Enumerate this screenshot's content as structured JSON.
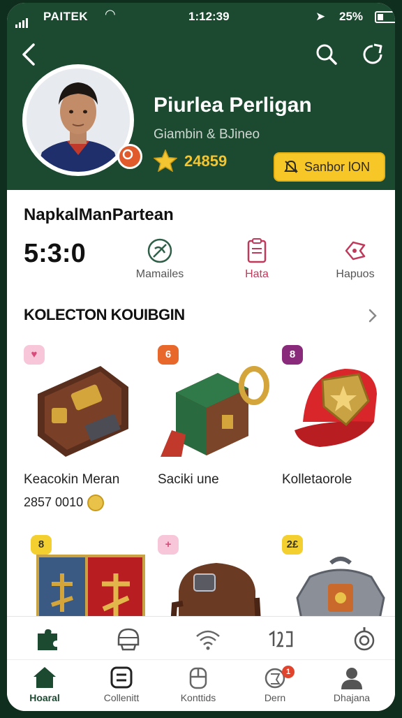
{
  "status_bar": {
    "carrier": "PAITEK",
    "time": "1:12:39",
    "battery": "25%"
  },
  "profile": {
    "name": "Piurlea Perligan",
    "subtitle": "Giambin & BJineo",
    "score": "24859",
    "status_button": "Sanbor lON"
  },
  "section_title": "NapkalManPartean",
  "stats": {
    "big_value": "5:3:0",
    "items": [
      {
        "label": "Mamailes",
        "icon": "compass-icon"
      },
      {
        "label": "Hata",
        "icon": "clipboard-icon"
      },
      {
        "label": "Hapuos",
        "icon": "tag-icon"
      }
    ]
  },
  "collection": {
    "title": "KOLECTON KOUIBGIN",
    "items": [
      {
        "badge": "♥",
        "badge_color": "#f7c7d9",
        "title": "Keacokin Meran",
        "price": "2857 0010",
        "icon": "wallet-icon"
      },
      {
        "badge": "6",
        "badge_color": "#e8682c",
        "title": "Saciki une",
        "price": "",
        "icon": "chest-icon"
      },
      {
        "badge": "8",
        "badge_color": "#8a2a7a",
        "title": "Kolletaorole",
        "price": "",
        "icon": "cap-icon"
      },
      {
        "badge": "8",
        "badge_color": "#f3cf2f",
        "title": "",
        "price": "",
        "icon": "banner-icon"
      },
      {
        "badge": "+",
        "badge_color": "#f7c7d9",
        "title": "",
        "price": "",
        "icon": "backpack-icon"
      },
      {
        "badge": "2£",
        "badge_color": "#f3cf2f",
        "title": "",
        "price": "",
        "icon": "armor-icon"
      }
    ]
  },
  "tabs": [
    {
      "label": "Hoaral",
      "icon": "home-icon"
    },
    {
      "label": "Collenitt",
      "icon": "collection-icon"
    },
    {
      "label": "Konttids",
      "icon": "controller-icon"
    },
    {
      "label": "Dern",
      "icon": "trophy-icon",
      "badge": "1"
    },
    {
      "label": "Dhajana",
      "icon": "user-icon"
    }
  ],
  "colors": {
    "header": "#1b4a31",
    "accent": "#f6c727",
    "active_tab": "#1b4a31"
  }
}
